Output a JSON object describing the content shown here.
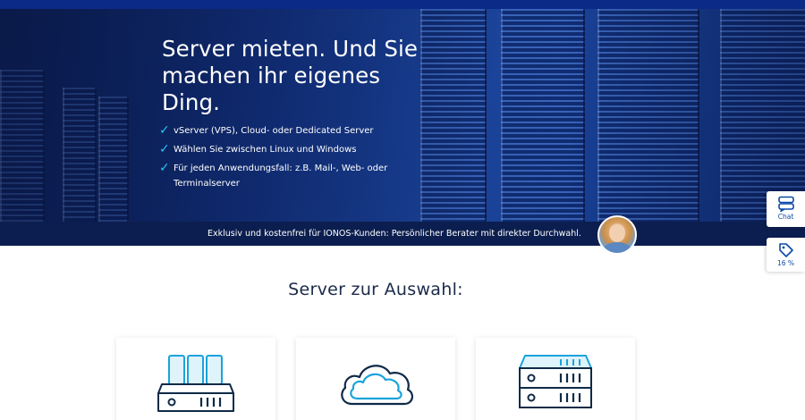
{
  "hero": {
    "title_lines": [
      "Server mieten. Und Sie",
      "machen ihr eigenes",
      "Ding."
    ],
    "features": [
      "vServer (VPS), Cloud- oder Dedicated Server",
      "Wählen Sie zwischen Linux und Windows",
      "Für jeden Anwendungsfall: z.B. Mail-, Web- oder Terminalserver"
    ]
  },
  "advisor_bar": {
    "text": "Exklusiv und kostenfrei für IONOS-Kunden: Persönlicher Berater mit direkter Durchwahl."
  },
  "side_widgets": {
    "chat_label": "Chat",
    "discount_label": "16 %"
  },
  "section": {
    "title": "Server zur Auswahl:"
  },
  "server_cards": [
    {
      "icon": "vps-server-icon"
    },
    {
      "icon": "cloud-icon"
    },
    {
      "icon": "dedicated-server-icon"
    }
  ],
  "colors": {
    "top_bar": "#0b2a88",
    "advisor_bar": "#0c1e4f",
    "check_accent": "#27c5f0",
    "icon_accent": "#1aa3dc",
    "icon_dark": "#0e2a47",
    "widget_blue": "#0b4aa8",
    "section_title": "#1b2a4a"
  }
}
